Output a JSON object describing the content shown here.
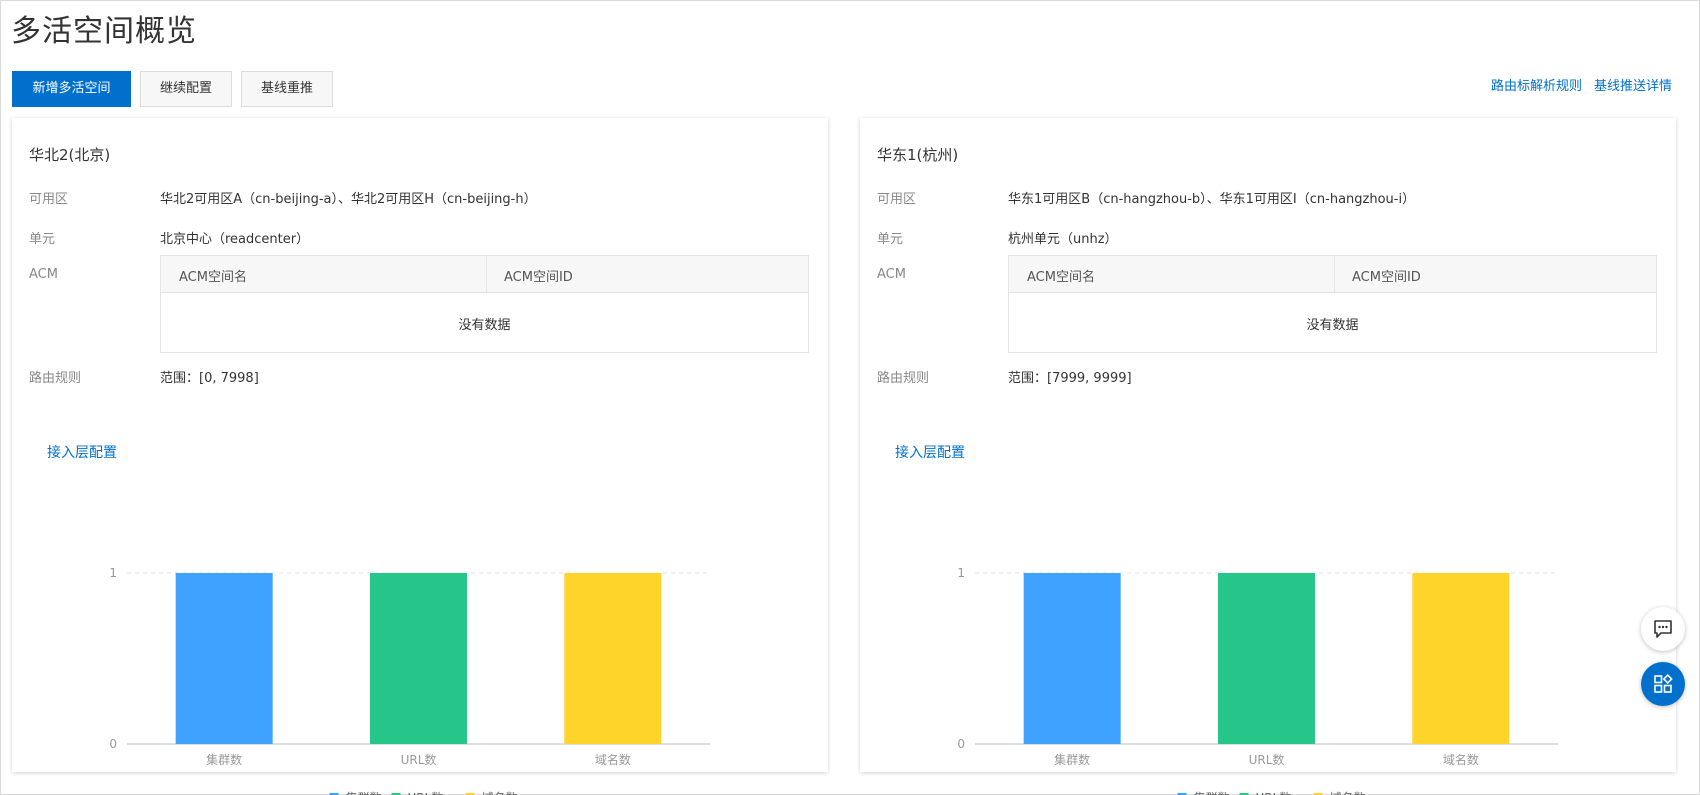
{
  "page": {
    "title": "多活空间概览"
  },
  "toolbar": {
    "add_label": "新增多活空间",
    "continue_label": "继续配置",
    "rebase_label": "基线重推"
  },
  "links": {
    "route_rules": "路由标解析规则",
    "baseline_detail": "基线推送详情"
  },
  "labels": {
    "zone": "可用区",
    "unit": "单元",
    "acm": "ACM",
    "route": "路由规则",
    "acm_name_col": "ACM空间名",
    "acm_id_col": "ACM空间ID",
    "empty": "没有数据",
    "access_config": "接入层配置"
  },
  "regions": [
    {
      "title": "华北2(北京)",
      "zones": "华北2可用区A（cn-beijing-a）、华北2可用区H（cn-beijing-h）",
      "unit": "北京中心（readcenter）",
      "route": "范围：[0, 7998]"
    },
    {
      "title": "华东1(杭州)",
      "zones": "华东1可用区B（cn-hangzhou-b）、华东1可用区I（cn-hangzhou-i）",
      "unit": "杭州单元（unhz）",
      "route": "范围：[7999, 9999]"
    }
  ],
  "chart_data": [
    {
      "type": "bar",
      "categories": [
        "集群数",
        "URL数",
        "域名数"
      ],
      "values": [
        1,
        1,
        1
      ],
      "colors": [
        "#3fa2fd",
        "#26c58a",
        "#ffd42a"
      ],
      "yticks": [
        "0",
        "1"
      ],
      "ylim": [
        0,
        1
      ],
      "legend": [
        "集群数",
        "URL数",
        "域名数"
      ],
      "legend_position": "bottom",
      "grid": true
    },
    {
      "type": "bar",
      "categories": [
        "集群数",
        "URL数",
        "域名数"
      ],
      "values": [
        1,
        1,
        1
      ],
      "colors": [
        "#3fa2fd",
        "#26c58a",
        "#ffd42a"
      ],
      "yticks": [
        "0",
        "1"
      ],
      "ylim": [
        0,
        1
      ],
      "legend": [
        "集群数",
        "URL数",
        "域名数"
      ],
      "legend_position": "bottom",
      "grid": true
    }
  ],
  "icons": {
    "chat": "chat-bubble-icon",
    "apps": "apps-grid-icon"
  }
}
